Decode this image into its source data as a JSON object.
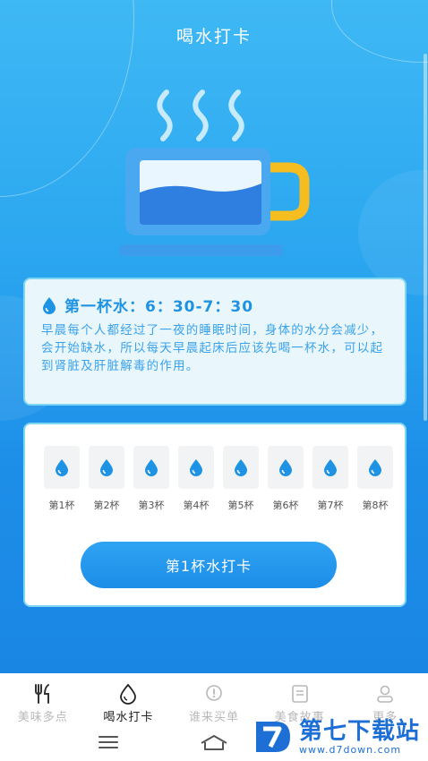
{
  "header": {
    "title": "喝水打卡"
  },
  "info": {
    "heading": "第一杯水：6：30-7：30",
    "body": "早晨每个人都经过了一夜的睡眠时间，身体的水分会减少，会开始缺水，所以每天早晨起床后应该先喝一杯水，可以起到肾脏及肝脏解毒的作用。"
  },
  "cups": [
    {
      "label": "第1杯",
      "icon": "water-drop-icon"
    },
    {
      "label": "第2杯",
      "icon": "water-drop-icon"
    },
    {
      "label": "第3杯",
      "icon": "water-drop-icon"
    },
    {
      "label": "第4杯",
      "icon": "water-drop-icon"
    },
    {
      "label": "第5杯",
      "icon": "water-drop-icon"
    },
    {
      "label": "第6杯",
      "icon": "water-drop-icon"
    },
    {
      "label": "第7杯",
      "icon": "water-drop-icon"
    },
    {
      "label": "第8杯",
      "icon": "water-drop-icon"
    }
  ],
  "checkin": {
    "button_label": "第1杯水打卡"
  },
  "tabs": [
    {
      "label": "美味多点",
      "icon": "fork-knife-icon",
      "active": false
    },
    {
      "label": "喝水打卡",
      "icon": "water-drop-icon",
      "active": true
    },
    {
      "label": "谁来买单",
      "icon": "exclamation-bubble-icon",
      "active": false
    },
    {
      "label": "美食故事",
      "icon": "document-icon",
      "active": false
    },
    {
      "label": "更多",
      "icon": "person-icon",
      "active": false
    }
  ],
  "watermark": {
    "main": "第七下载站",
    "sub": "www.d7down.com"
  },
  "colors": {
    "primary": "#1f93e3",
    "hero_top": "#3fb8f4",
    "hero_bottom": "#1a86e4",
    "card_border": "#7fd6f2",
    "cup_handle": "#f5bd1f"
  }
}
